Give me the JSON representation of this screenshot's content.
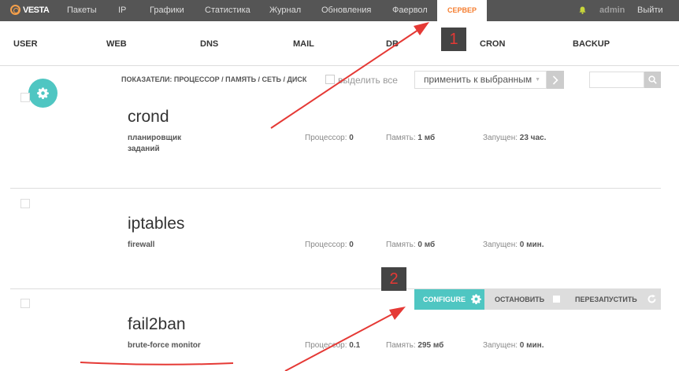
{
  "topnav": {
    "logo": "VESTA",
    "items": [
      "Пакеты",
      "IP",
      "Графики",
      "Статистика",
      "Журнал",
      "Обновления",
      "Фаервол",
      "СЕРВЕР"
    ],
    "active_index": 7,
    "user": "admin",
    "logout": "Выйти"
  },
  "secnav": [
    "USER",
    "WEB",
    "DNS",
    "MAIL",
    "DB",
    "CRON",
    "BACKUP"
  ],
  "toolbar": {
    "metrics_label": "ПОКАЗАТЕЛИ: ПРОЦЕССОР / ПАМЯТЬ / СЕТЬ / ДИСК",
    "select_all": "выделить все",
    "apply_selected": "применить к выбранным",
    "search_placeholder": ""
  },
  "services": [
    {
      "name": "crond",
      "desc": "планировщик заданий",
      "cpu_label": "Процессор:",
      "cpu": "0",
      "mem_label": "Память:",
      "mem": "1 мб",
      "up_label": "Запущен:",
      "up": "23 час."
    },
    {
      "name": "iptables",
      "desc": "firewall",
      "cpu_label": "Процессор:",
      "cpu": "0",
      "mem_label": "Память:",
      "mem": "0 мб",
      "up_label": "Запущен:",
      "up": "0 мин."
    },
    {
      "name": "fail2ban",
      "desc": "brute-force monitor",
      "cpu_label": "Процессор:",
      "cpu": "0.1",
      "mem_label": "Память:",
      "mem": "295 мб",
      "up_label": "Запущен:",
      "up": "0 мин."
    }
  ],
  "actions": {
    "configure": "CONFIGURE",
    "stop": "ОСТАНОВИТЬ",
    "restart": "ПЕРЕЗАПУСТИТЬ"
  },
  "annotations": {
    "badge1": "1",
    "badge2": "2"
  },
  "colors": {
    "accent": "#4fc6c2",
    "active_nav": "#f57d2f",
    "topbar": "#555555",
    "annotation": "#e53935"
  },
  "icons": {
    "logo": "vesta-logo-icon",
    "bell": "bell-icon",
    "gear": "gear-icon",
    "search": "search-icon",
    "arrow": "chevron-right-icon",
    "stop": "stop-icon",
    "restart": "refresh-icon"
  }
}
